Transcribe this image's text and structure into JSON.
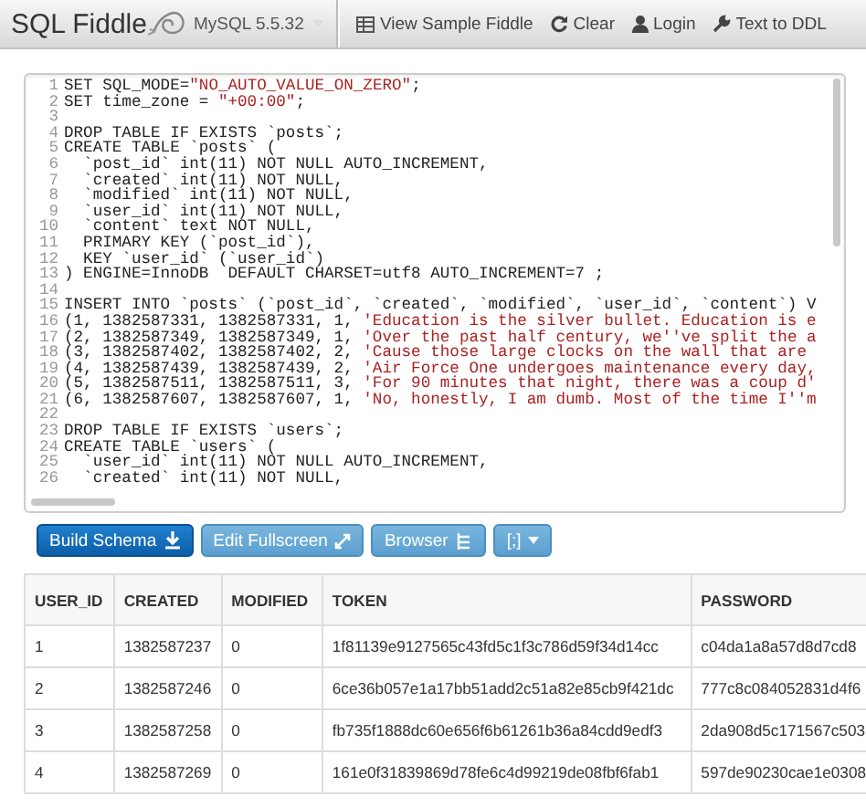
{
  "navbar": {
    "logo": "SQL Fiddle",
    "database": "MySQL 5.5.32",
    "links": [
      {
        "kind": "sample",
        "label": "View Sample Fiddle"
      },
      {
        "kind": "clear",
        "label": "Clear"
      },
      {
        "kind": "login",
        "label": "Login"
      },
      {
        "kind": "ddl",
        "label": "Text to DDL"
      }
    ]
  },
  "editor": {
    "lines": [
      {
        "number": "1",
        "code": "SET SQL_MODE=\"NO_AUTO_VALUE_ON_ZERO\";"
      },
      {
        "number": "2",
        "code": "SET time_zone = \"+00:00\";"
      },
      {
        "number": "3"
      },
      {
        "number": "4",
        "code": "DROP TABLE IF EXISTS `posts`;"
      },
      {
        "number": "5",
        "code": "CREATE TABLE `posts` ("
      },
      {
        "number": "6",
        "code": "  `post_id` int(11) NOT NULL AUTO_INCREMENT,"
      },
      {
        "number": "7",
        "code": "  `created` int(11) NOT NULL,"
      },
      {
        "number": "8",
        "code": "  `modified` int(11) NOT NULL,"
      },
      {
        "number": "9",
        "code": "  `user_id` int(11) NOT NULL,"
      },
      {
        "number": "10",
        "code": "  `content` text NOT NULL,"
      },
      {
        "number": "11",
        "code": "  PRIMARY KEY (`post_id`),"
      },
      {
        "number": "12",
        "code": "  KEY `user_id` (`user_id`)"
      },
      {
        "number": "13",
        "code": ") ENGINE=InnoDB  DEFAULT CHARSET=utf8 AUTO_INCREMENT=7 ;"
      },
      {
        "number": "14"
      },
      {
        "number": "15",
        "code": "INSERT INTO `posts` (`post_id`, `created`, `modified`, `user_id`, `content`) V"
      },
      {
        "number": "16",
        "code": "(1, 1382587331, 1382587331, 1, 'Education is the silver bullet. Education is e"
      },
      {
        "number": "17",
        "code": "(2, 1382587349, 1382587349, 1, 'Over the past half century, we''ve split the a"
      },
      {
        "number": "18",
        "code": "(3, 1382587402, 1382587402, 2, 'Cause those large clocks on the wall that are"
      },
      {
        "number": "19",
        "code": "(4, 1382587439, 1382587439, 2, 'Air Force One undergoes maintenance every day,"
      },
      {
        "number": "20",
        "code": "(5, 1382587511, 1382587511, 3, 'For 90 minutes that night, there was a coup d'"
      },
      {
        "number": "21",
        "code": "(6, 1382587607, 1382587607, 1, 'No, honestly, I am dumb. Most of the time I''m"
      },
      {
        "number": "22"
      },
      {
        "number": "23",
        "code": "DROP TABLE IF EXISTS `users`;"
      },
      {
        "number": "24",
        "code": "CREATE TABLE `users` ("
      },
      {
        "number": "25",
        "code": "  `user_id` int(11) NOT NULL AUTO_INCREMENT,"
      },
      {
        "number": "26",
        "code": "  `created` int(11) NOT NULL,"
      }
    ]
  },
  "buttons": [
    {
      "kind": "build",
      "label": "Build Schema"
    },
    {
      "kind": "fullscreen",
      "label": "Edit Fullscreen"
    },
    {
      "kind": "browser",
      "label": "Browser"
    },
    {
      "kind": "delimiter",
      "label": "[;]"
    }
  ],
  "table": {
    "columns": [
      "USER_ID",
      "CREATED",
      "MODIFIED",
      "TOKEN",
      "PASSWORD"
    ],
    "rows": [
      [
        "1",
        "1382587237",
        "0",
        "1f81139e9127565c43fd5c1f3c786d59f34d14cc",
        "c04da1a8a57d8d7cd8"
      ],
      [
        "2",
        "1382587246",
        "0",
        "6ce36b057e1a17bb51add2c51a82e85cb9f421dc",
        "777c8c084052831d4f6"
      ],
      [
        "3",
        "1382587258",
        "0",
        "fb735f1888dc60e656f6b61261b36a84cdd9edf3",
        "2da908d5c171567c503"
      ],
      [
        "4",
        "1382587269",
        "0",
        "161e0f31839869d78fe6c4d99219de08fbf6fab1",
        "597de90230cae1e0308"
      ]
    ]
  }
}
